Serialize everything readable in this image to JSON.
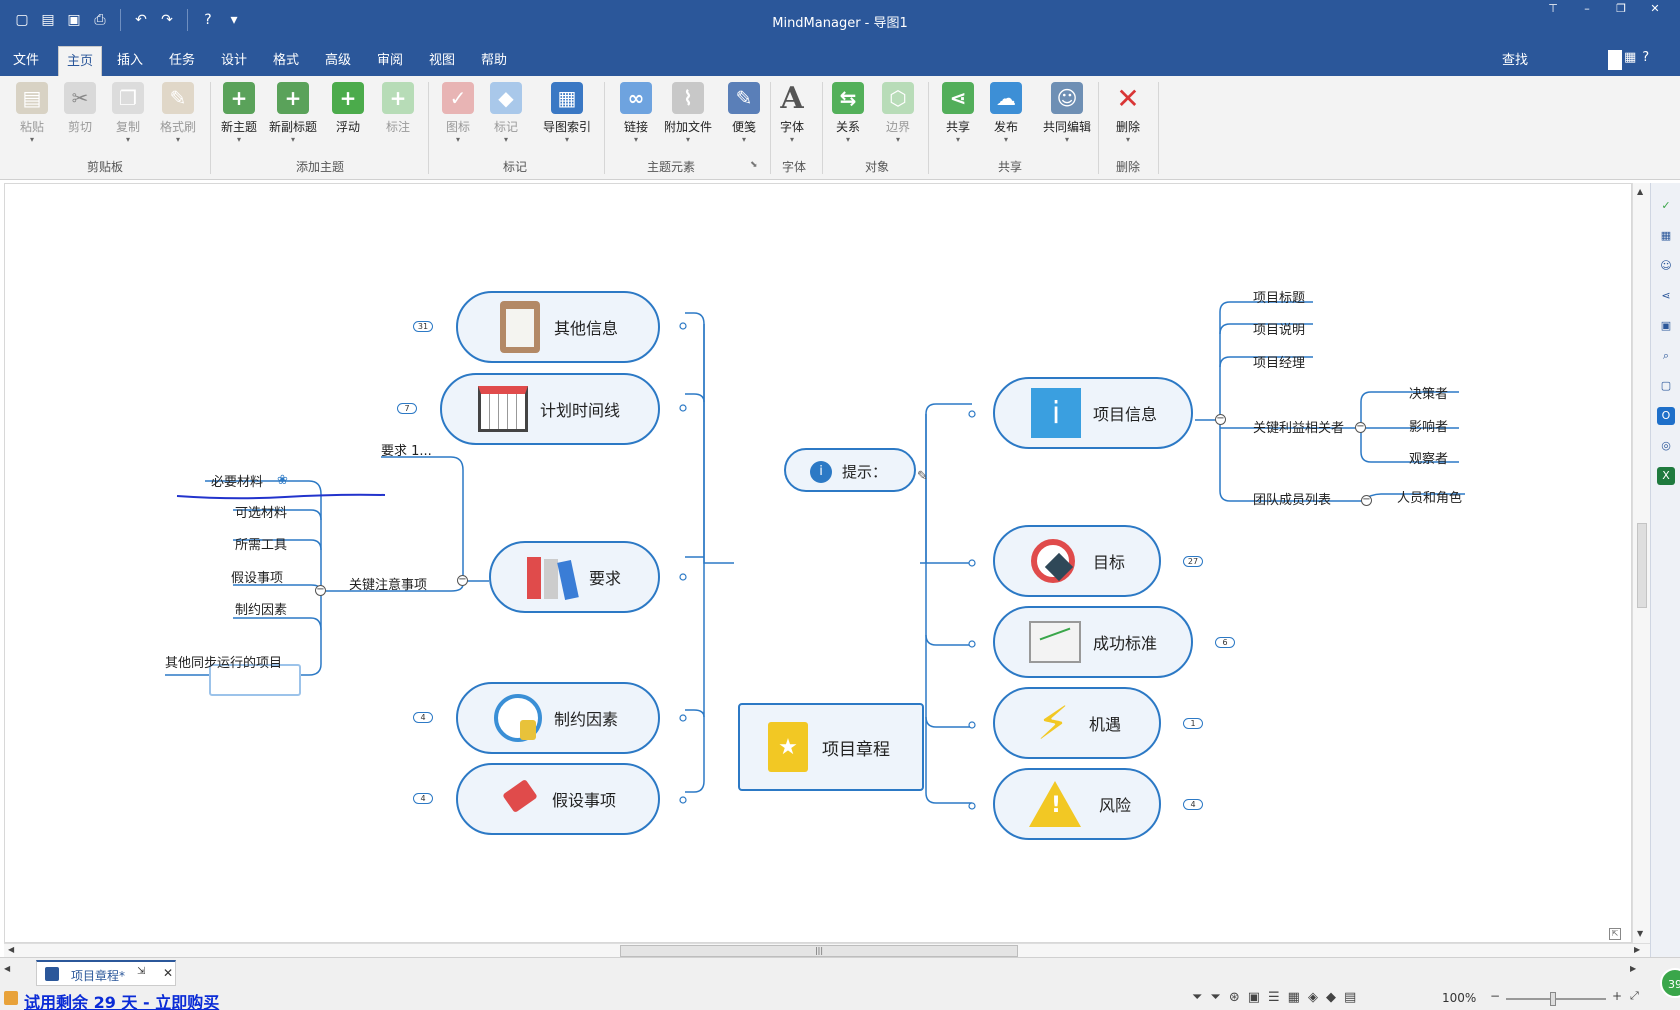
{
  "app": {
    "title": "MindManager - 导图1"
  },
  "menu": {
    "tabs": [
      {
        "label": "文件"
      },
      {
        "label": "主页"
      },
      {
        "label": "插入"
      },
      {
        "label": "任务"
      },
      {
        "label": "设计"
      },
      {
        "label": "格式"
      },
      {
        "label": "高级"
      },
      {
        "label": "审阅"
      },
      {
        "label": "视图"
      },
      {
        "label": "帮助"
      }
    ],
    "search": "查找"
  },
  "ribbon": {
    "buttons": [
      {
        "label": "粘贴"
      },
      {
        "label": "剪切"
      },
      {
        "label": "复制"
      },
      {
        "label": "格式刷"
      },
      {
        "label": "新主题"
      },
      {
        "label": "新副标题"
      },
      {
        "label": "浮动"
      },
      {
        "label": "标注"
      },
      {
        "label": "图标"
      },
      {
        "label": "标记"
      },
      {
        "label": "导图索引"
      },
      {
        "label": "链接"
      },
      {
        "label": "附加文件"
      },
      {
        "label": "便笺"
      },
      {
        "label": "字体"
      },
      {
        "label": "关系"
      },
      {
        "label": "边界"
      },
      {
        "label": "共享"
      },
      {
        "label": "发布"
      },
      {
        "label": "共同编辑"
      },
      {
        "label": "删除"
      }
    ],
    "groups": [
      {
        "label": "剪贴板"
      },
      {
        "label": "添加主题"
      },
      {
        "label": "标记"
      },
      {
        "label": "主题元素"
      },
      {
        "label": "字体"
      },
      {
        "label": "对象"
      },
      {
        "label": "共享"
      },
      {
        "label": "删除"
      }
    ]
  },
  "map": {
    "central": "项目章程",
    "callout": "提示：",
    "left_topics": [
      {
        "label": "其他信息",
        "badge": "31"
      },
      {
        "label": "计划时间线",
        "badge": "7"
      },
      {
        "label": "要求"
      },
      {
        "label": "制约因素",
        "badge": "4"
      },
      {
        "label": "假设事项",
        "badge": "4"
      }
    ],
    "right_topics": [
      {
        "label": "项目信息"
      },
      {
        "label": "目标",
        "badge": "27"
      },
      {
        "label": "成功标准",
        "badge": "6"
      },
      {
        "label": "机遇",
        "badge": "1"
      },
      {
        "label": "风险",
        "badge": "4"
      }
    ],
    "requirements": {
      "req1": "要求 1...",
      "key": "关键注意事项",
      "items": [
        "必要材料",
        "可选材料",
        "所需工具",
        "假设事项",
        "制约因素",
        "其他同步运行的项目"
      ]
    },
    "info": {
      "items": [
        "项目标题",
        "项目说明",
        "项目经理",
        "关键利益相关者",
        "团队成员列表"
      ],
      "stakeholders": [
        "决策者",
        "影响者",
        "观察者"
      ],
      "team": "人员和角色"
    }
  },
  "tabs": {
    "doc": "项目章程*"
  },
  "status": {
    "trial": "试用剩余 29 天 - 立即购买",
    "zoom": "100%",
    "badge": "39"
  },
  "colors": {
    "brand": "#2b579a",
    "topic_border": "#2c79c5",
    "topic_fill": "#eef4fb"
  }
}
